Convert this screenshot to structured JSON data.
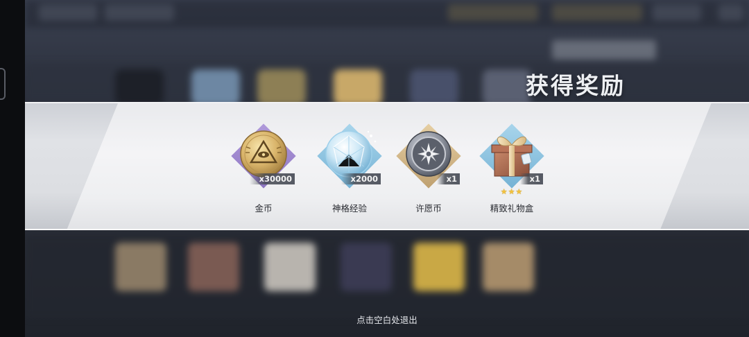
{
  "panel": {
    "title": "获得奖励"
  },
  "rewards": [
    {
      "name": "金币",
      "count": "x30000",
      "icon": "gold-coin-icon",
      "frame_color": "#c9a76b",
      "stars": ""
    },
    {
      "name": "神格经验",
      "count": "x2000",
      "icon": "crystal-orb-icon",
      "frame_color": "#7fbcdc",
      "stars": ""
    },
    {
      "name": "许愿币",
      "count": "x1",
      "icon": "wish-coin-icon",
      "frame_color": "#c9a76b",
      "stars": ""
    },
    {
      "name": "精致礼物盒",
      "count": "x1",
      "icon": "gift-box-icon",
      "frame_color": "#7fbcdc",
      "stars": "★★★"
    }
  ],
  "footer": {
    "exit_hint": "点击空白处退出"
  },
  "colors": {
    "banner": "#f1f2f4",
    "title": "#eef0f3",
    "star": "#f3c23c"
  }
}
